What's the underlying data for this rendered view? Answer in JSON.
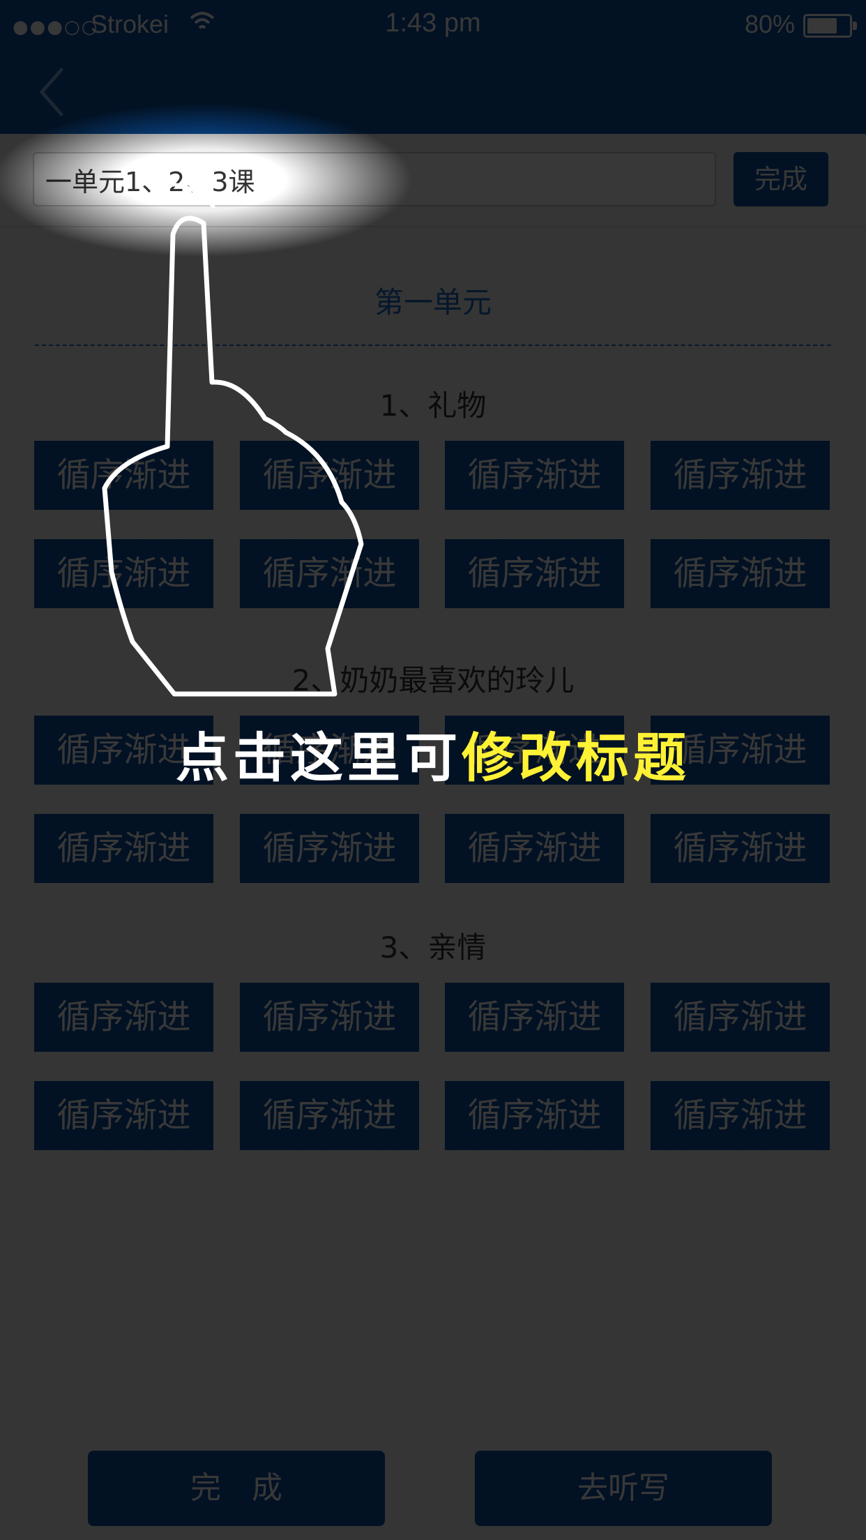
{
  "status_bar": {
    "signal": "●●●○○",
    "carrier": "Strokei",
    "time": "1:43 pm",
    "battery": "80%",
    "battery_level": 0.8
  },
  "title_input": {
    "value": "一单元1、2、3课"
  },
  "done_top_label": "完成",
  "unit_title": "第一单元",
  "lessons": [
    {
      "title": "1、礼物",
      "tiles": [
        "循序渐进",
        "循序渐进",
        "循序渐进",
        "循序渐进",
        "循序渐进",
        "循序渐进",
        "循序渐进",
        "循序渐进"
      ]
    },
    {
      "title": "2、奶奶最喜欢的玲儿",
      "tiles": [
        "循序渐进",
        "循序渐进",
        "循序渐进",
        "循序渐进",
        "循序渐进",
        "循序渐进",
        "循序渐进",
        "循序渐进"
      ]
    },
    {
      "title": "3、亲情",
      "tiles": [
        "循序渐进",
        "循序渐进",
        "循序渐进",
        "循序渐进",
        "循序渐进",
        "循序渐进",
        "循序渐进",
        "循序渐进"
      ]
    }
  ],
  "bottom": {
    "done_label": "完　成",
    "dictation_label": "去听写"
  },
  "hint": {
    "part1": "点击这里可",
    "part2": "修改标题"
  },
  "colors": {
    "primary": "#0a4f9e",
    "accent_text": "#1a67c6",
    "highlight": "#fff235"
  }
}
